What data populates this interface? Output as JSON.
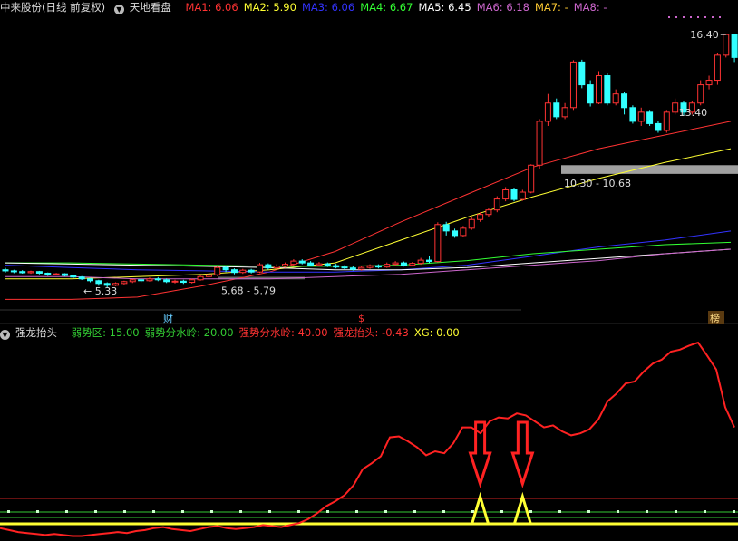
{
  "top_header": {
    "title": "中来股份(日线 前复权)",
    "indicator_name": "天地看盘",
    "ma": [
      {
        "label": "MA1:",
        "value": "6.06",
        "color": "#ff3333"
      },
      {
        "label": "MA2:",
        "value": "5.90",
        "color": "#ffff33"
      },
      {
        "label": "MA3:",
        "value": "6.06",
        "color": "#3333ff"
      },
      {
        "label": "MA4:",
        "value": "6.67",
        "color": "#33ff33"
      },
      {
        "label": "MA5:",
        "value": "6.45",
        "color": "#ffffff"
      },
      {
        "label": "MA6:",
        "value": "6.18",
        "color": "#cc66cc"
      },
      {
        "label": "MA7:",
        "value": "-",
        "color": "#ffcc33"
      },
      {
        "label": "MA8:",
        "value": "-",
        "color": "#cc66cc"
      }
    ]
  },
  "bottom_header": {
    "indicator_name": "强龙抬头",
    "items": [
      {
        "label": "弱势区:",
        "value": "15.00",
        "color": "#33cc33"
      },
      {
        "label": "弱势分水岭:",
        "value": "20.00",
        "color": "#33cc33"
      },
      {
        "label": "强势分水岭:",
        "value": "40.00",
        "color": "#ff3333"
      },
      {
        "label": "强龙抬头:",
        "value": "-0.43",
        "color": "#ff3333"
      },
      {
        "label": "XG:",
        "value": "0.00",
        "color": "#ffff33"
      }
    ]
  },
  "price_labels": {
    "high": "16.40",
    "low": "5.33",
    "recent_low": "13.40",
    "zone_high": "10.30 - 10.68",
    "zone_low": "5.68 - 5.79"
  },
  "markers": {
    "cai": "财",
    "s": "$",
    "bang": "榜"
  },
  "colors": {
    "up": "#ff3333",
    "down": "#33ffff",
    "background": "#000000",
    "ma1": "#ff3333",
    "ma2": "#ffff33",
    "ma3": "#3333ff",
    "ma4": "#33ff33",
    "ma5": "#ffffff",
    "ma6": "#cc66cc",
    "zone": "#a0a0a0",
    "signal_arrow": "#ff2222"
  },
  "chart_data": [
    {
      "type": "candlestick",
      "ylim": [
        4.5,
        17.2
      ],
      "candles": [
        [
          6.1,
          6.05,
          6.18,
          5.98
        ],
        [
          6.05,
          6.02,
          6.1,
          5.95
        ],
        [
          6.02,
          5.97,
          6.08,
          5.93
        ],
        [
          5.97,
          6.02,
          6.06,
          5.92
        ],
        [
          6.02,
          5.95,
          6.05,
          5.9
        ],
        [
          5.95,
          5.88,
          5.98,
          5.83
        ],
        [
          5.88,
          5.92,
          5.96,
          5.85
        ],
        [
          5.92,
          5.85,
          5.95,
          5.8
        ],
        [
          5.85,
          5.78,
          5.88,
          5.72
        ],
        [
          5.78,
          5.7,
          5.82,
          5.65
        ],
        [
          5.7,
          5.62,
          5.74,
          5.55
        ],
        [
          5.62,
          5.5,
          5.66,
          5.4
        ],
        [
          5.5,
          5.42,
          5.55,
          5.33
        ],
        [
          5.42,
          5.5,
          5.55,
          5.38
        ],
        [
          5.5,
          5.58,
          5.62,
          5.45
        ],
        [
          5.58,
          5.66,
          5.7,
          5.52
        ],
        [
          5.66,
          5.62,
          5.72,
          5.55
        ],
        [
          5.62,
          5.7,
          5.76,
          5.58
        ],
        [
          5.7,
          5.66,
          5.78,
          5.6
        ],
        [
          5.66,
          5.58,
          5.72,
          5.52
        ],
        [
          5.58,
          5.6,
          5.66,
          5.5
        ],
        [
          5.6,
          5.55,
          5.66,
          5.48
        ],
        [
          5.55,
          5.66,
          5.72,
          5.5
        ],
        [
          5.66,
          5.8,
          5.86,
          5.62
        ],
        [
          5.8,
          5.88,
          5.94,
          5.75
        ],
        [
          5.88,
          6.2,
          6.28,
          5.82
        ],
        [
          6.2,
          6.1,
          6.26,
          6.0
        ],
        [
          6.1,
          5.98,
          6.16,
          5.9
        ],
        [
          5.98,
          6.08,
          6.14,
          5.92
        ],
        [
          6.08,
          6.0,
          6.14,
          5.94
        ],
        [
          6.0,
          6.32,
          6.4,
          5.96
        ],
        [
          6.32,
          6.18,
          6.38,
          6.1
        ],
        [
          6.18,
          6.26,
          6.34,
          6.12
        ],
        [
          6.26,
          6.34,
          6.42,
          6.2
        ],
        [
          6.34,
          6.48,
          6.56,
          6.28
        ],
        [
          6.48,
          6.4,
          6.56,
          6.34
        ],
        [
          6.4,
          6.3,
          6.48,
          6.26
        ],
        [
          6.3,
          6.36,
          6.44,
          6.24
        ],
        [
          6.36,
          6.28,
          6.42,
          6.22
        ],
        [
          6.28,
          6.22,
          6.36,
          6.16
        ],
        [
          6.22,
          6.18,
          6.3,
          6.12
        ],
        [
          6.18,
          6.12,
          6.26,
          6.06
        ],
        [
          6.12,
          6.2,
          6.28,
          6.06
        ],
        [
          6.2,
          6.28,
          6.34,
          6.14
        ],
        [
          6.28,
          6.22,
          6.34,
          6.16
        ],
        [
          6.22,
          6.34,
          6.42,
          6.18
        ],
        [
          6.34,
          6.4,
          6.48,
          6.28
        ],
        [
          6.4,
          6.3,
          6.46,
          6.24
        ],
        [
          6.3,
          6.38,
          6.44,
          6.26
        ],
        [
          6.38,
          6.52,
          6.62,
          6.32
        ],
        [
          6.52,
          6.46,
          6.7,
          6.4
        ],
        [
          6.46,
          8.08,
          8.18,
          6.42
        ],
        [
          8.08,
          7.8,
          8.2,
          7.6
        ],
        [
          7.8,
          7.6,
          7.9,
          7.5
        ],
        [
          7.6,
          7.92,
          8.02,
          7.55
        ],
        [
          7.92,
          8.3,
          8.4,
          7.85
        ],
        [
          8.3,
          8.52,
          8.62,
          8.2
        ],
        [
          8.52,
          8.72,
          8.82,
          8.4
        ],
        [
          8.72,
          9.2,
          9.32,
          8.62
        ],
        [
          9.2,
          9.6,
          9.72,
          9.1
        ],
        [
          9.6,
          9.18,
          9.7,
          9.1
        ],
        [
          9.18,
          9.5,
          9.6,
          9.12
        ],
        [
          9.5,
          10.68,
          10.72,
          9.45
        ],
        [
          10.68,
          12.6,
          12.7,
          10.5
        ],
        [
          12.6,
          13.4,
          13.8,
          12.4
        ],
        [
          13.4,
          12.8,
          13.6,
          12.7
        ],
        [
          12.8,
          13.2,
          13.4,
          12.7
        ],
        [
          13.2,
          15.2,
          15.28,
          13.1
        ],
        [
          15.2,
          14.2,
          15.3,
          14.05
        ],
        [
          14.2,
          13.4,
          14.4,
          13.25
        ],
        [
          13.4,
          14.6,
          14.8,
          13.35
        ],
        [
          14.6,
          13.4,
          14.7,
          13.3
        ],
        [
          13.4,
          13.8,
          14.0,
          13.3
        ],
        [
          13.8,
          13.2,
          13.9,
          12.9
        ],
        [
          13.2,
          12.6,
          13.3,
          12.5
        ],
        [
          12.6,
          13.0,
          13.2,
          12.4
        ],
        [
          13.0,
          12.5,
          13.1,
          12.4
        ],
        [
          12.5,
          12.2,
          12.6,
          12.1
        ],
        [
          12.2,
          13.0,
          13.1,
          12.1
        ],
        [
          13.0,
          13.4,
          13.6,
          12.9
        ],
        [
          13.4,
          13.0,
          13.5,
          12.85
        ],
        [
          13.0,
          13.4,
          13.5,
          12.9
        ],
        [
          13.4,
          14.2,
          14.4,
          13.3
        ],
        [
          14.2,
          14.4,
          14.6,
          14.0
        ],
        [
          14.4,
          15.5,
          15.6,
          14.2
        ],
        [
          15.5,
          16.4,
          16.4,
          15.4
        ],
        [
          16.4,
          15.4,
          16.4,
          15.2
        ]
      ],
      "moving_averages": [
        {
          "name": "MA1",
          "values": [
            4.8,
            4.8,
            4.9,
            5.4,
            6.0,
            6.9,
            8.2,
            9.4,
            10.6,
            11.4,
            12.0,
            12.6
          ]
        },
        {
          "name": "MA2",
          "values": [
            5.7,
            5.7,
            5.8,
            5.9,
            6.1,
            6.4,
            7.4,
            8.4,
            9.3,
            10.1,
            10.8,
            11.4
          ]
        },
        {
          "name": "MA3",
          "values": [
            6.3,
            6.2,
            6.1,
            6.05,
            6.0,
            6.0,
            6.1,
            6.3,
            6.7,
            7.1,
            7.4,
            7.8
          ]
        },
        {
          "name": "MA4",
          "values": [
            6.4,
            6.4,
            6.35,
            6.3,
            6.25,
            6.25,
            6.3,
            6.5,
            6.8,
            7.0,
            7.2,
            7.3
          ]
        },
        {
          "name": "MA5",
          "values": [
            6.4,
            6.35,
            6.3,
            6.25,
            6.2,
            6.1,
            6.1,
            6.2,
            6.4,
            6.6,
            6.8,
            7.0
          ]
        },
        {
          "name": "MA6",
          "values": [
            5.8,
            5.8,
            5.7,
            5.7,
            5.7,
            5.8,
            5.9,
            6.1,
            6.3,
            6.5,
            6.8,
            7.0
          ]
        }
      ],
      "zones": [
        {
          "label": "10.30 - 10.68",
          "low": 10.3,
          "high": 10.68
        },
        {
          "label": "5.68 - 5.79",
          "low": 5.68,
          "high": 5.79
        }
      ]
    },
    {
      "type": "line",
      "title": "强龙抬头",
      "ylim": [
        -6,
        55
      ],
      "levels": [
        {
          "name": "弱势区",
          "value": 15.0
        },
        {
          "name": "弱势分水岭",
          "value": 20.0
        },
        {
          "name": "强势分水岭",
          "value": 40.0
        }
      ],
      "series": [
        {
          "name": "强龙抬头",
          "values": [
            3,
            1,
            -1,
            -2,
            -3,
            -4,
            -3,
            -4,
            -5,
            -5,
            -4,
            -3,
            -2,
            -1,
            -2,
            0,
            1,
            3,
            4,
            2,
            1,
            0,
            2,
            4,
            5,
            3,
            2,
            3,
            4,
            6,
            5,
            4,
            6,
            8,
            12,
            18,
            25,
            30,
            36,
            46,
            62,
            68,
            75,
            94,
            95,
            90,
            84,
            76,
            80,
            78,
            88,
            104,
            104,
            98,
            110,
            114,
            113,
            118,
            116,
            110,
            104,
            106,
            100,
            96,
            98,
            102,
            112,
            130,
            138,
            148,
            150,
            160,
            168,
            172,
            180,
            182,
            186,
            189,
            176,
            162,
            124,
            104
          ]
        },
        {
          "name": "XG",
          "signals": [
            56,
            61
          ]
        }
      ]
    }
  ]
}
